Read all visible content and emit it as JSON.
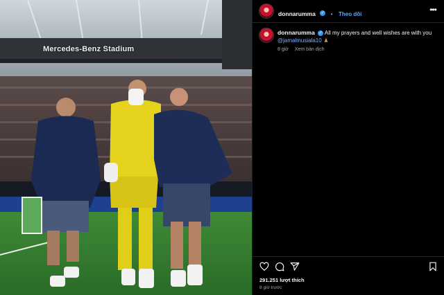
{
  "photo": {
    "stadium_sign": "Mercedes-Benz Stadium",
    "alt_subject": "goalkeeper-injury-photo"
  },
  "post": {
    "username": "donnarumma",
    "follow_label": "Theo dõi",
    "separator": "•",
    "caption_text": "All my prayers and well wishes are with you",
    "mention": "@jamalmusiala10",
    "comment_age": "8 giờ",
    "see_translation": "Xem bản dịch",
    "likes": "291.251 lượt thích",
    "post_age": "8 giờ trước"
  },
  "icons": {
    "more": "more-options-icon",
    "like": "heart-icon",
    "comment": "comment-icon",
    "share": "share-icon",
    "save": "bookmark-icon"
  },
  "colors": {
    "panel_bg": "#000000",
    "link": "#5aa7ff",
    "verified": "#3897f0",
    "muted": "#a8a8a8"
  }
}
